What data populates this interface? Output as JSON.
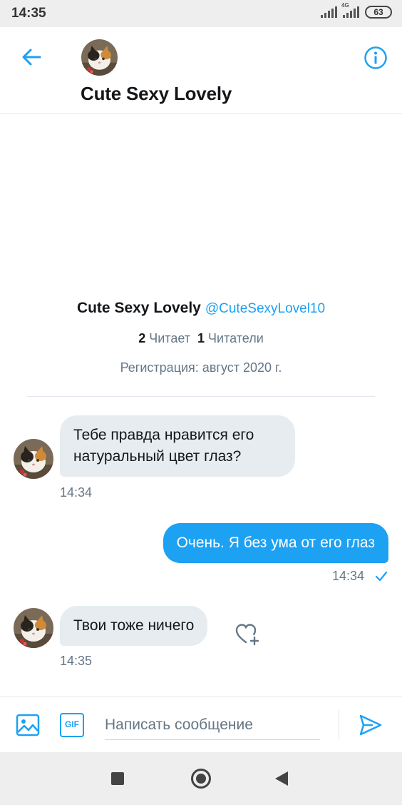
{
  "status_bar": {
    "time": "14:35",
    "network_label": "4G",
    "battery": "63",
    "icons": [
      "signal-icon",
      "signal-4g-icon",
      "battery-icon"
    ]
  },
  "header": {
    "title": "Cute Sexy Lovely",
    "back_icon": "arrow-left-icon",
    "info_icon": "info-icon"
  },
  "profile": {
    "name": "Cute Sexy Lovely",
    "handle": "@CuteSexyLovel10",
    "following_count": "2",
    "following_label": "Читает",
    "followers_count": "1",
    "followers_label": "Читатели",
    "registration": "Регистрация: август 2020 г."
  },
  "messages": [
    {
      "direction": "incoming",
      "text": "Тебе правда нравится его натуральный цвет глаз?",
      "time": "14:34"
    },
    {
      "direction": "outgoing",
      "text": "Очень. Я без ума от его глаз",
      "time": "14:34",
      "read": true
    },
    {
      "direction": "incoming",
      "text": "Твои тоже ничего",
      "time": "14:35"
    }
  ],
  "composer": {
    "placeholder": "Написать сообщение",
    "gif_label": "GIF",
    "icons": [
      "image-icon",
      "gif-icon",
      "send-icon"
    ]
  },
  "colors": {
    "accent": "#1da1f2",
    "incoming_bubble": "#e6ecf0",
    "muted_text": "#657786",
    "status_bar_bg": "#eeeeee"
  }
}
